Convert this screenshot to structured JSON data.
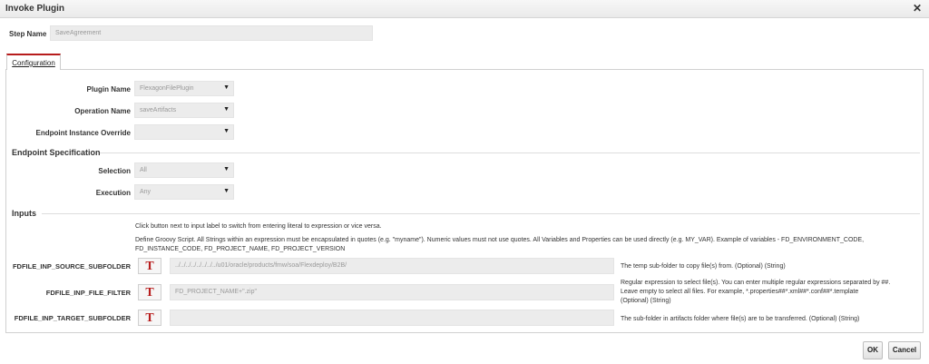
{
  "dialog": {
    "title": "Invoke Plugin",
    "close_glyph": "✕"
  },
  "step": {
    "label": "Step Name",
    "value": "SaveAgreement"
  },
  "tabs": [
    {
      "label": "Configuration",
      "active": true
    }
  ],
  "fields": {
    "plugin_name": {
      "label": "Plugin Name",
      "value": "FlexagonFilePlugin"
    },
    "operation_name": {
      "label": "Operation Name",
      "value": "saveArtifacts"
    },
    "endpoint_override": {
      "label": "Endpoint Instance Override",
      "value": ""
    }
  },
  "endpoint_spec": {
    "title": "Endpoint Specification",
    "selection": {
      "label": "Selection",
      "value": "All"
    },
    "execution": {
      "label": "Execution",
      "value": "Any"
    }
  },
  "inputs": {
    "title": "Inputs",
    "help1": "Click button next to input label to switch from entering literal to expression or vice versa.",
    "help2a": "Define Groovy Script. All Strings within an expression must be encapsulated in quotes (e.g. \"myname\"). Numeric values must not use quotes. All Variables and Properties can be used directly (e.g. MY_VAR). Example of variables - FD_ENVIRONMENT_CODE,",
    "help2b": "FD_INSTANCE_CODE, FD_PROJECT_NAME, FD_PROJECT_VERSION",
    "toggle_glyph": "T",
    "rows": [
      {
        "label": "FDFILE_INP_SOURCE_SUBFOLDER",
        "value": "../../../../../../../../u01/oracle/products/fmw/soa/Flexdeploy/B2B/",
        "desc1": "The temp sub-folder to copy file(s) from. (Optional) (String)",
        "desc2": "",
        "desc3": ""
      },
      {
        "label": "FDFILE_INP_FILE_FILTER",
        "value": "FD_PROJECT_NAME+\".zip\"",
        "desc1": "Regular expression to select file(s). You can enter multiple regular expressions separated by ##.",
        "desc2": "Leave empty to select all files. For example, *.properties##*.xml##*.conf##*.template",
        "desc3": "(Optional) (String)"
      },
      {
        "label": "FDFILE_INP_TARGET_SUBFOLDER",
        "value": "",
        "desc1": "The sub-folder in artifacts folder where file(s) are to be transferred. (Optional) (String)",
        "desc2": "",
        "desc3": ""
      }
    ]
  },
  "footer": {
    "ok_label": "OK",
    "cancel_label": "Cancel"
  }
}
